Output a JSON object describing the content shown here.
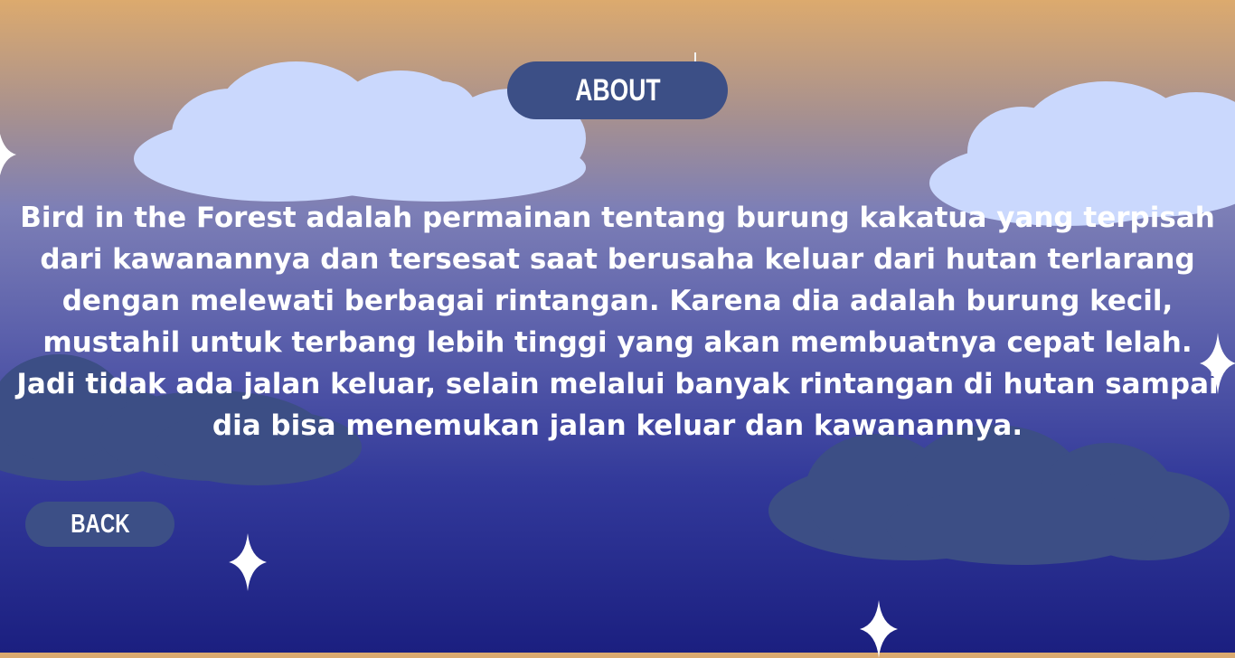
{
  "screen": "about",
  "about_label": "ABOUT",
  "back_label": "BACK",
  "description": "Bird in the Forest adalah permainan tentang burung kakatua yang terpisah dari kawanannya dan tersesat saat berusaha keluar dari hutan terlarang dengan melewati berbagai rintangan. Karena dia adalah burung kecil, mustahil untuk terbang lebih tinggi yang akan membuatnya cepat lelah. Jadi tidak ada jalan keluar, selain melalui banyak rintangan di hutan sampai dia bisa menemukan jalan keluar dan kawanannya.",
  "colors": {
    "sky_top": "#dcaa6e",
    "sky_bottom": "#1b1f80",
    "light_cloud": "#cad8fd",
    "dark_cloud": "#3c4e85",
    "button": "#3c4f86",
    "text": "#ffffff"
  },
  "icons": [
    "sparkle-star-icon",
    "light-cloud",
    "dark-cloud"
  ]
}
